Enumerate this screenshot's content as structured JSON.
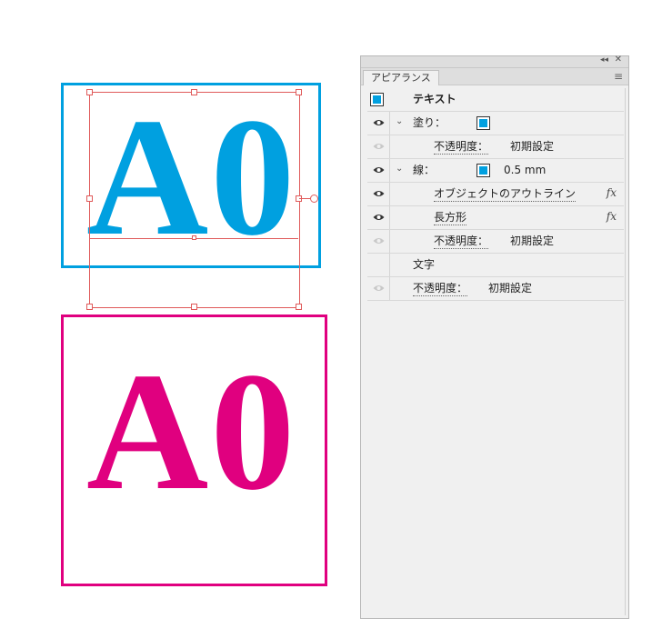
{
  "artwork": {
    "cyan_text": "A0",
    "magenta_text": "A0",
    "cyan_color": "#00a0e0",
    "magenta_color": "#e0007f",
    "selection_color": "#e05a5a"
  },
  "panel": {
    "tab_label": "アピアランス",
    "collapse_icon": "◂◂",
    "close_icon": "✕",
    "menu_icon": "≡",
    "header": {
      "label": "テキスト"
    },
    "fill": {
      "label": "塗り：",
      "swatch_color": "#00a0e0"
    },
    "fill_opacity": {
      "label": "不透明度：",
      "value": "初期設定"
    },
    "stroke": {
      "label": "線：",
      "swatch_color": "#00a0e0",
      "value": "0.5 mm"
    },
    "effect_outline": {
      "label": "オブジェクトのアウトライン",
      "fx": "fx"
    },
    "effect_rect": {
      "label": "長方形",
      "fx": "fx"
    },
    "stroke_opacity": {
      "label": "不透明度：",
      "value": "初期設定"
    },
    "characters": {
      "label": "文字"
    },
    "char_opacity": {
      "label": "不透明度：",
      "value": "初期設定"
    }
  }
}
